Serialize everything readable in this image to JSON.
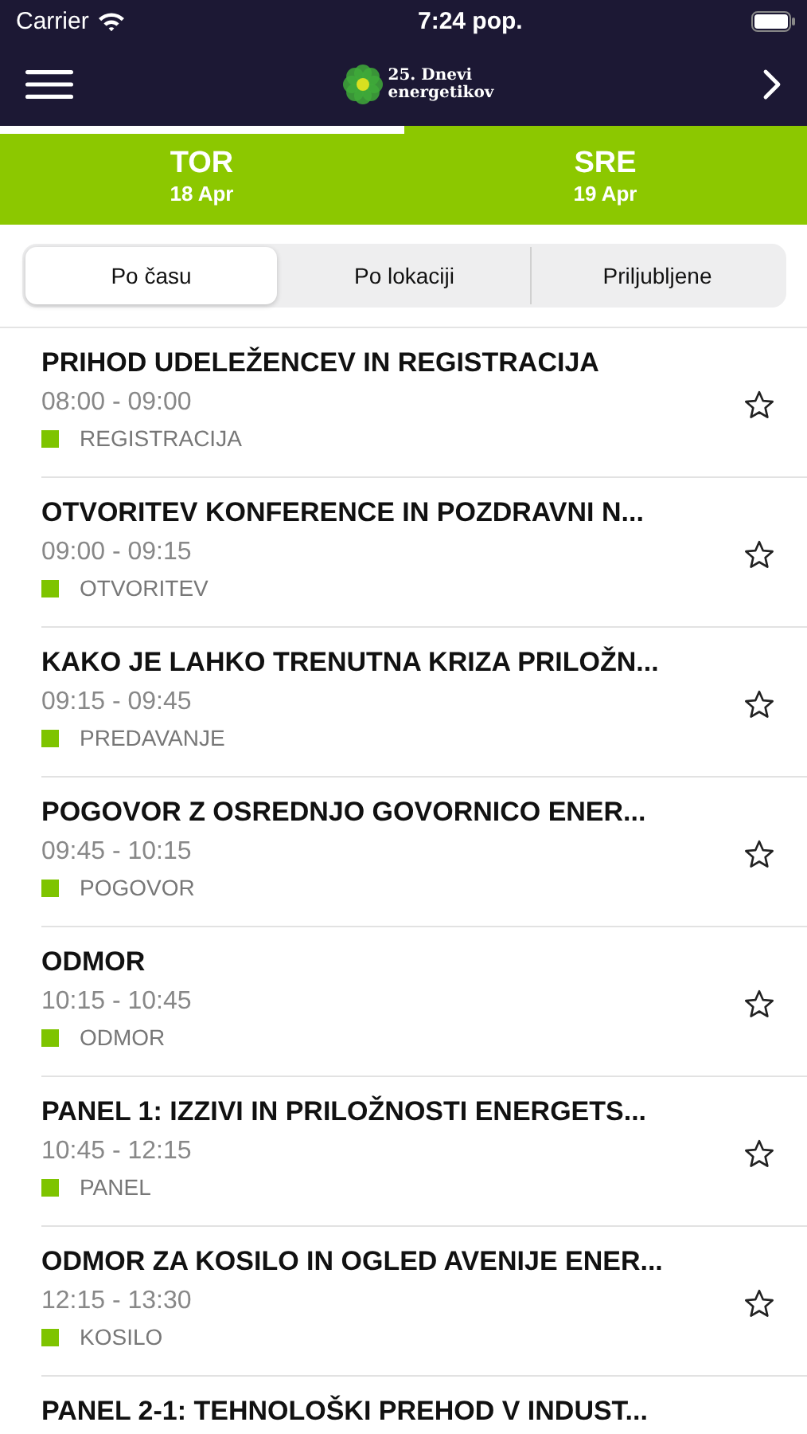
{
  "status_bar": {
    "carrier": "Carrier",
    "time": "7:24 pop."
  },
  "nav_bar": {
    "logo_line_1": "25. Dnevi",
    "logo_line_2": "energetikov"
  },
  "day_tabs": [
    {
      "day": "TOR",
      "date": "18 Apr",
      "selected": true
    },
    {
      "day": "SRE",
      "date": "19 Apr",
      "selected": false
    }
  ],
  "segments": [
    {
      "label": "Po času",
      "selected": true
    },
    {
      "label": "Po lokaciji",
      "selected": false
    },
    {
      "label": "Priljubljene",
      "selected": false
    }
  ],
  "sessions": [
    {
      "title": "PRIHOD UDELEŽENCEV IN REGISTRACIJA",
      "time": "08:00 - 09:00",
      "category": "REGISTRACIJA",
      "starred": false
    },
    {
      "title": "OTVORITEV KONFERENCE IN POZDRAVNI N...",
      "time": "09:00 - 09:15",
      "category": "OTVORITEV",
      "starred": false
    },
    {
      "title": "KAKO JE LAHKO TRENUTNA KRIZA PRILOŽN...",
      "time": "09:15 - 09:45",
      "category": "PREDAVANJE",
      "starred": false
    },
    {
      "title": "POGOVOR Z OSREDNJO GOVORNICO ENER...",
      "time": "09:45 - 10:15",
      "category": "POGOVOR",
      "starred": false
    },
    {
      "title": "ODMOR",
      "time": "10:15 - 10:45",
      "category": "ODMOR",
      "starred": false
    },
    {
      "title": "PANEL 1: IZZIVI IN PRILOŽNOSTI ENERGETS...",
      "time": "10:45 - 12:15",
      "category": "PANEL",
      "starred": false
    },
    {
      "title": "ODMOR ZA KOSILO IN OGLED AVENIJE ENER...",
      "time": "12:15 - 13:30",
      "category": "KOSILO",
      "starred": false
    },
    {
      "title": "PANEL 2-1: TEHNOLOŠKI PREHOD V INDUST..."
    }
  ]
}
